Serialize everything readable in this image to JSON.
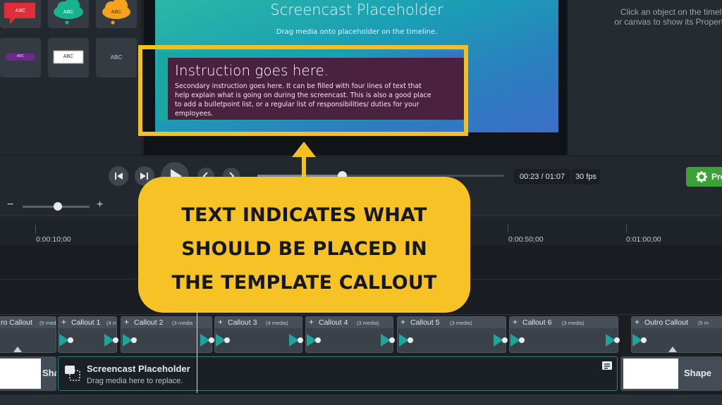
{
  "annotations_panel": {
    "tiles": [
      {
        "label": "ABC"
      },
      {
        "label": "ABC"
      },
      {
        "label": "ABC"
      },
      {
        "label": "ABC"
      },
      {
        "label": "ABC"
      },
      {
        "label": "ABC"
      }
    ]
  },
  "canvas": {
    "title": "Screencast Placeholder",
    "subtitle": "Drag media onto placeholder on the timeline.",
    "instruction_title": "Instruction goes here.",
    "instruction_body": "Secondary instruction goes here. It can be filled with four lines of text that help explain what is going on during the screencast. This is also a good place to add a bulletpoint list, or a regular list of responsibilities/ duties for your employees."
  },
  "properties_panel": {
    "message_line1": "Click an object on the timeli",
    "message_line2": "or canvas to show its Propert"
  },
  "playback": {
    "time": "00:23 / 01:07",
    "fps": "30 fps",
    "produce_label": "Pro",
    "progress_fraction": 0.343
  },
  "zoom": {
    "minus": "−",
    "plus": "+",
    "level_fraction": 0.53
  },
  "ruler": {
    "labels": [
      "0:00:10;00",
      "0:00:50;00",
      "0:01:00;00"
    ]
  },
  "timeline": {
    "clips": [
      {
        "name": "ro Callout",
        "meta": "(5 med"
      },
      {
        "name": "Callout 1",
        "meta": "(4 m"
      },
      {
        "name": "Callout 2",
        "meta": "(3 media"
      },
      {
        "name": "Callout 3",
        "meta": "(4 media)"
      },
      {
        "name": "Callout 4",
        "meta": "(3 media)"
      },
      {
        "name": "Callout 5",
        "meta": "(3 media)"
      },
      {
        "name": "Callout 6",
        "meta": "(3 media)"
      },
      {
        "name": "Outro Callout",
        "meta": "(5 m"
      }
    ],
    "media_clip": {
      "title": "Screencast Placeholder",
      "subtitle": "Drag media here to replace."
    },
    "shape_left_label": "Sha",
    "shape_right_label": "Shape"
  },
  "overlay": {
    "line1": "TEXT INDICATES WHAT",
    "line2": "SHOULD BE PLACED IN",
    "line3": "THE TEMPLATE CALLOUT"
  },
  "colors": {
    "highlight": "#f2c021",
    "produce_green": "#3aa335",
    "lower_third": "#4a213f"
  }
}
